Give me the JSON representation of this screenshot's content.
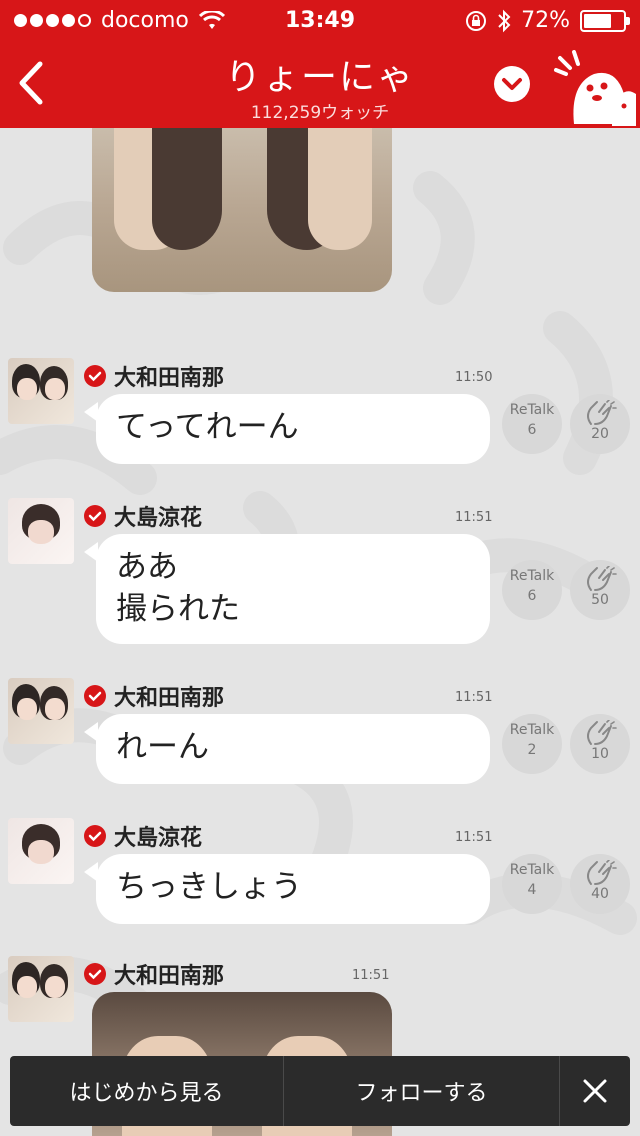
{
  "status_bar": {
    "carrier": "docomo",
    "time": "13:49",
    "battery": "72%",
    "battery_level": 0.72,
    "signal_bars_filled": 4,
    "signal_bars_total": 5
  },
  "header": {
    "title": "りょーにゃ",
    "subtitle": "112,259ウォッチ"
  },
  "messages": [
    {
      "sender": "大和田南那",
      "time": "11:50",
      "text": "てってれーん",
      "retalk_label": "ReTalk",
      "retalk_count": "6",
      "clap_count": "20"
    },
    {
      "sender": "大島涼花",
      "time": "11:51",
      "text": "ああ\n撮られた",
      "retalk_label": "ReTalk",
      "retalk_count": "6",
      "clap_count": "50"
    },
    {
      "sender": "大和田南那",
      "time": "11:51",
      "text": "れーん",
      "retalk_label": "ReTalk",
      "retalk_count": "2",
      "clap_count": "10"
    },
    {
      "sender": "大島涼花",
      "time": "11:51",
      "text": "ちっきしょう",
      "retalk_label": "ReTalk",
      "retalk_count": "4",
      "clap_count": "40"
    },
    {
      "sender": "大和田南那",
      "time": "11:51"
    }
  ],
  "toolbar": {
    "start_label": "はじめから見る",
    "follow_label": "フォローする",
    "close_icon": "close-icon"
  },
  "colors": {
    "brand_red": "#d71618",
    "background": "#e4e4e4",
    "bubble": "#ffffff",
    "toolbar": "#2b2b2b"
  }
}
